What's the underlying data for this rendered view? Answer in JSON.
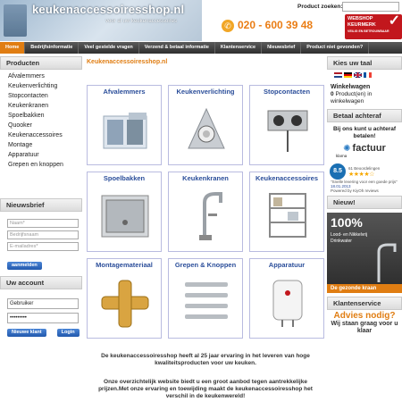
{
  "header": {
    "logo_text": "keukenaccessoiresshop.nl",
    "logo_tagline": "voor al uw keukenaccessoires",
    "phone": "020 - 600 39 48",
    "search_label": "Product zoeken:",
    "search_placeholder": "",
    "keurmerk_line1": "WEBSHOP",
    "keurmerk_line2": "KEURMERK",
    "keurmerk_line3": "VEILIG EN BETROUWBAAR"
  },
  "nav": [
    {
      "label": "Home",
      "active": true
    },
    {
      "label": "Bedrijfsinformatie"
    },
    {
      "label": "Veel gestelde vragen"
    },
    {
      "label": "Verzend & betaal informatie"
    },
    {
      "label": "Klantenservice"
    },
    {
      "label": "Nieuwsbrief"
    },
    {
      "label": "Product niet gevonden?"
    }
  ],
  "left": {
    "products_title": "Producten",
    "categories": [
      "Afvalemmers",
      "Keukenverlichting",
      "Stopcontacten",
      "Keukenkranen",
      "Spoelbakken",
      "Quooker",
      "Keukenaccessoires",
      "Montage",
      "Apparatuur",
      "Grepen en knoppen"
    ],
    "newsletter_title": "Nieuwsbrief",
    "newsletter_fields": [
      "Naam*",
      "Bedrijfsnaam",
      "E-mailadres*"
    ],
    "newsletter_button": "aanmelden",
    "account_title": "Uw account",
    "account_user": "Gebruiker",
    "account_pass": "•••••••••",
    "new_customer_button": "Nieuwe klant",
    "login_button": "Login"
  },
  "center": {
    "title": "Keukenaccessoiresshop.nl",
    "tiles": [
      {
        "title": "Afvalemmers",
        "icon": "waste-bin"
      },
      {
        "title": "Keukenverlichting",
        "icon": "kitchen-light"
      },
      {
        "title": "Stopcontacten",
        "icon": "power-socket"
      },
      {
        "title": "Spoelbakken",
        "icon": "sink"
      },
      {
        "title": "Keukenkranen",
        "icon": "tap"
      },
      {
        "title": "Keukenaccessoires",
        "icon": "accessories"
      },
      {
        "title": "Montagemateriaal",
        "icon": "fitting"
      },
      {
        "title": "Grepen & Knoppen",
        "icon": "handles"
      },
      {
        "title": "Apparatuur",
        "icon": "boiler"
      }
    ],
    "description_1": "De keukenaccessoiresshop heeft al 25 jaar ervaring in het leveren van hoge kwaliteitsproducten voor uw keuken.",
    "description_2": "Onze overzichtelijk website biedt u een groot aanbod tegen aantrekkelijke prijzen.Met onze ervaring en toewijding maakt de keukenaccessoiresshop het verschil in de keukenwereld!"
  },
  "right": {
    "language_title": "Kies uw taal",
    "cart_title": "Winkelwagen",
    "cart_count": "0",
    "cart_text": "Product(en) in winkelwagen",
    "pay_title": "Betaal achteraf",
    "klarna_text": "Bij ons kunt u achteraf betalen!",
    "factuur_logo": "factuur",
    "klarna_label": "klarna",
    "rating_score": "8.5",
    "rating_reviews": "61 Beoordelingen",
    "rating_quote": "\"Snelle levering voor een goede prijs\"",
    "rating_date": "18.01.2013",
    "rating_source": "Powered by KiyOh reviews",
    "new_title": "Nieuw!",
    "promo_pct": "100%",
    "promo_line1": "Lood- en Nikkelvrij",
    "promo_line2": "Drinkwater",
    "promo_bottom": "De gezonde kraan",
    "service_title": "Klantenservice",
    "advice_line1": "Advies nodig?",
    "advice_line2": "Wij staan graag voor u klaar"
  },
  "colors": {
    "accent": "#e07d12",
    "link": "#2b4e9a",
    "nav_bg": "#3a3a3a"
  }
}
